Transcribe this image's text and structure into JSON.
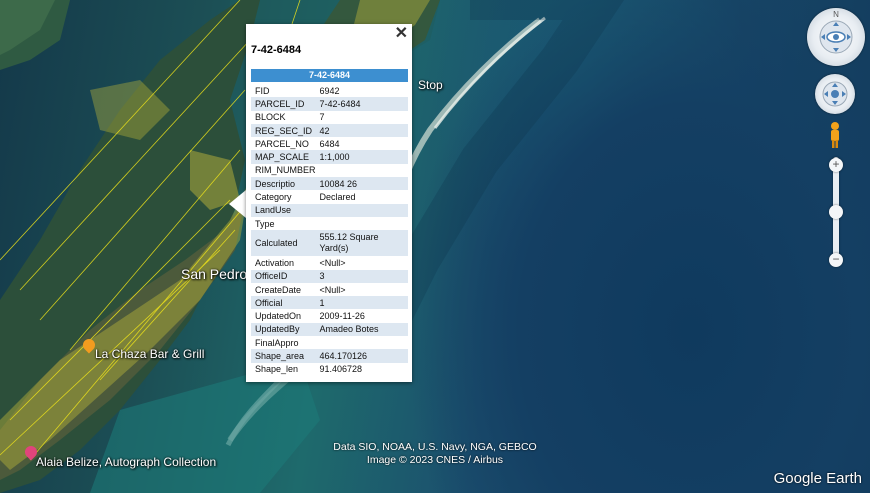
{
  "popup": {
    "title": "7-42-6484",
    "header": "7-42-6484",
    "close_glyph": "✕",
    "rows": [
      {
        "key": "FID",
        "value": "6942"
      },
      {
        "key": "PARCEL_ID",
        "value": "7-42-6484"
      },
      {
        "key": "BLOCK",
        "value": "7"
      },
      {
        "key": "REG_SEC_ID",
        "value": "42"
      },
      {
        "key": "PARCEL_NO",
        "value": "6484"
      },
      {
        "key": "MAP_SCALE",
        "value": "1:1,000"
      },
      {
        "key": "RIM_NUMBER",
        "value": ""
      },
      {
        "key": "Descriptio",
        "value": "10084 26"
      },
      {
        "key": "Category",
        "value": "Declared"
      },
      {
        "key": "LandUse",
        "value": ""
      },
      {
        "key": "Type",
        "value": ""
      },
      {
        "key": "Calculated",
        "value": "555.12 Square Yard(s)"
      },
      {
        "key": "Activation",
        "value": "<Null>"
      },
      {
        "key": "OfficeID",
        "value": "3"
      },
      {
        "key": "CreateDate",
        "value": "<Null>"
      },
      {
        "key": "Official",
        "value": "1"
      },
      {
        "key": "UpdatedOn",
        "value": "2009-11-26"
      },
      {
        "key": "UpdatedBy",
        "value": "Amadeo Botes"
      },
      {
        "key": "FinalAppro",
        "value": ""
      },
      {
        "key": "Shape_area",
        "value": "464.170126"
      },
      {
        "key": "Shape_len",
        "value": "91.406728"
      }
    ]
  },
  "map_labels": {
    "town": "San Pedro",
    "bar": "La Chaza Bar & Grill",
    "hotel": "Alaia Belize, Autograph Collection",
    "stop": "Stop"
  },
  "attribution": {
    "line1": "Data SIO, NOAA, U.S. Navy, NGA, GEBCO",
    "line2": "Image © 2023 CNES / Airbus"
  },
  "brand": "Google Earth",
  "nav": {
    "zoom_in": "+",
    "zoom_out": "−"
  },
  "colors": {
    "header_blue": "#3d8fd0",
    "parcel_lines": "#f0e51a",
    "pin_orange": "#f39c1f",
    "pin_pink": "#e0457b"
  }
}
